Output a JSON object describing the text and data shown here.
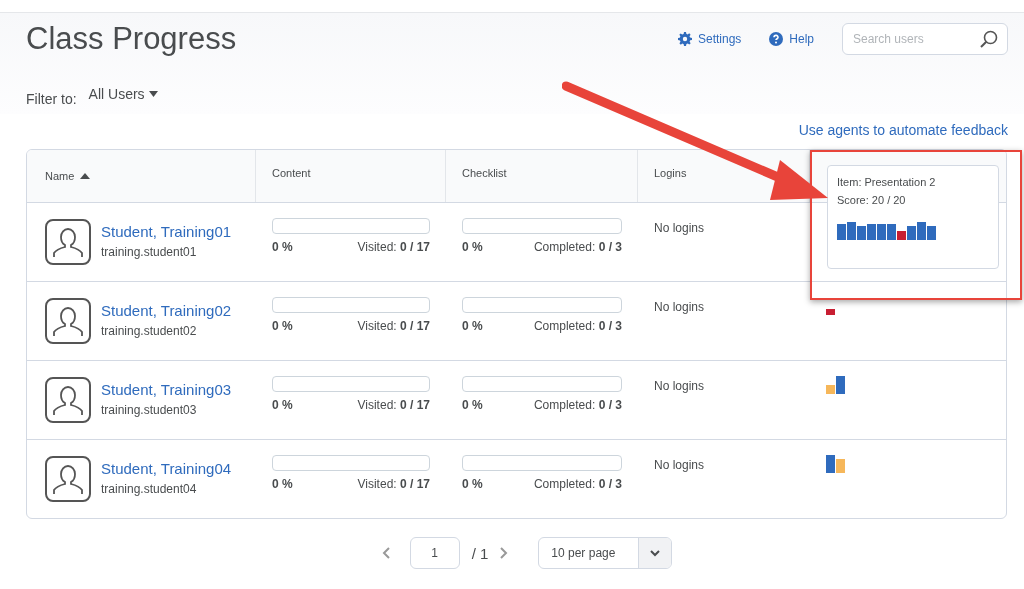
{
  "page": {
    "title": "Class Progress"
  },
  "toolbar": {
    "settings": "Settings",
    "help": "Help",
    "search": {
      "placeholder": "Search users"
    }
  },
  "filter": {
    "label": "Filter to:",
    "value": "All Users"
  },
  "agents_link": "Use agents to automate feedback",
  "table": {
    "columns": [
      {
        "label": "Name",
        "sorted": true
      },
      {
        "label": "Content",
        "sorted": false
      },
      {
        "label": "Checklist",
        "sorted": false
      },
      {
        "label": "Logins",
        "sorted": false
      }
    ],
    "rows": [
      {
        "name": "Student, Training01",
        "username": "training.student01",
        "content": {
          "level": 0,
          "percent": "0 %",
          "label": "Visited:",
          "count": "0 / 17"
        },
        "checklist": {
          "level": 0,
          "percent": "0 %",
          "label": "Completed:",
          "count": "0 / 3"
        },
        "logins": "No logins",
        "bars": [
          {
            "color": "#2f6bbd",
            "kind": "high"
          },
          {
            "color": "#2f6bbd",
            "kind": "full"
          },
          {
            "color": "#2f6bbd",
            "kind": "mid"
          },
          {
            "color": "#2f6bbd",
            "kind": "high"
          },
          {
            "color": "#2f6bbd",
            "kind": "high"
          },
          {
            "color": "#2f6bbd",
            "kind": "high"
          },
          {
            "color": "#c81e32",
            "kind": "low"
          },
          {
            "color": "#2f6bbd",
            "kind": "mid"
          },
          {
            "color": "#2f6bbd",
            "kind": "full"
          },
          {
            "color": "#2f6bbd",
            "kind": "mid"
          }
        ],
        "popover": {
          "item": "Item: Presentation 2",
          "score": "Score: 20 / 20"
        }
      },
      {
        "name": "Student, Training02",
        "username": "training.student02",
        "content": {
          "level": 0,
          "percent": "0 %",
          "label": "Visited:",
          "count": "0 / 17"
        },
        "checklist": {
          "level": 0,
          "percent": "0 %",
          "label": "Completed:",
          "count": "0 / 3"
        },
        "logins": "No logins",
        "bars": [
          {
            "color": "#c81e32",
            "kind": "min"
          }
        ]
      },
      {
        "name": "Student, Training03",
        "username": "training.student03",
        "content": {
          "level": 0,
          "percent": "0 %",
          "label": "Visited:",
          "count": "0 / 17"
        },
        "checklist": {
          "level": 0,
          "percent": "0 %",
          "label": "Completed:",
          "count": "0 / 3"
        },
        "logins": "No logins",
        "bars": [
          {
            "color": "#f6b75a",
            "kind": "low"
          },
          {
            "color": "#2f6bbd",
            "kind": "full"
          }
        ]
      },
      {
        "name": "Student, Training04",
        "username": "training.student04",
        "content": {
          "level": 0,
          "percent": "0 %",
          "label": "Visited:",
          "count": "0 / 17"
        },
        "checklist": {
          "level": 0,
          "percent": "0 %",
          "label": "Completed:",
          "count": "0 / 3"
        },
        "logins": "No logins",
        "bars": [
          {
            "color": "#2f6bbd",
            "kind": "full"
          },
          {
            "color": "#f6b75a",
            "kind": "mid"
          }
        ]
      }
    ]
  },
  "pagination": {
    "page": "1",
    "total": "/ 1",
    "per_page": "10 per page"
  }
}
